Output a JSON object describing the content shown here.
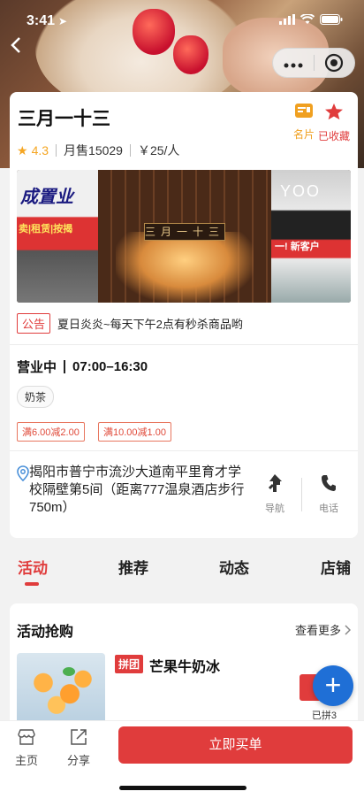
{
  "status_bar": {
    "time": "3:41"
  },
  "shop": {
    "name": "三月一十三",
    "card_label": "名片",
    "favorite_label": "已收藏",
    "rating": "4.3",
    "monthly_sales": "月售15029",
    "price_per_person": "￥25/人",
    "photo_signs": {
      "left_main": "成置业",
      "left_sub": "卖|租赁|按揭",
      "center": "三月一十三",
      "right_main": "YOO",
      "right_sub": "一! 新客户"
    },
    "notice_tag": "公告",
    "notice_text": "夏日炎炎~每天下午2点有秒杀商品哟",
    "status": "营业中",
    "hours": "07:00–16:30",
    "category": "奶茶",
    "promotions": [
      "满6.00减2.00",
      "满10.00减1.00"
    ],
    "address": "揭阳市普宁市流沙大道南平里育才学校隔壁第5间（距离777温泉酒店步行750m）",
    "navigate_label": "导航",
    "phone_label": "电话"
  },
  "tabs": [
    {
      "label": "活动",
      "active": true
    },
    {
      "label": "推荐",
      "active": false
    },
    {
      "label": "动态",
      "active": false
    },
    {
      "label": "店铺",
      "active": false
    }
  ],
  "flash_sale": {
    "title": "活动抢购",
    "more_label": "查看更多",
    "item": {
      "badge": "拼团",
      "name": "芒果牛奶冰",
      "joined": "已拼3"
    }
  },
  "fab": {
    "label": "+"
  },
  "bottom_bar": {
    "home_label": "主页",
    "share_label": "分享",
    "order_label": "立即买单"
  },
  "colors": {
    "accent": "#e03c3c",
    "star": "#f5a623",
    "fab": "#1f6fd6",
    "card_icon": "#f0a020"
  }
}
